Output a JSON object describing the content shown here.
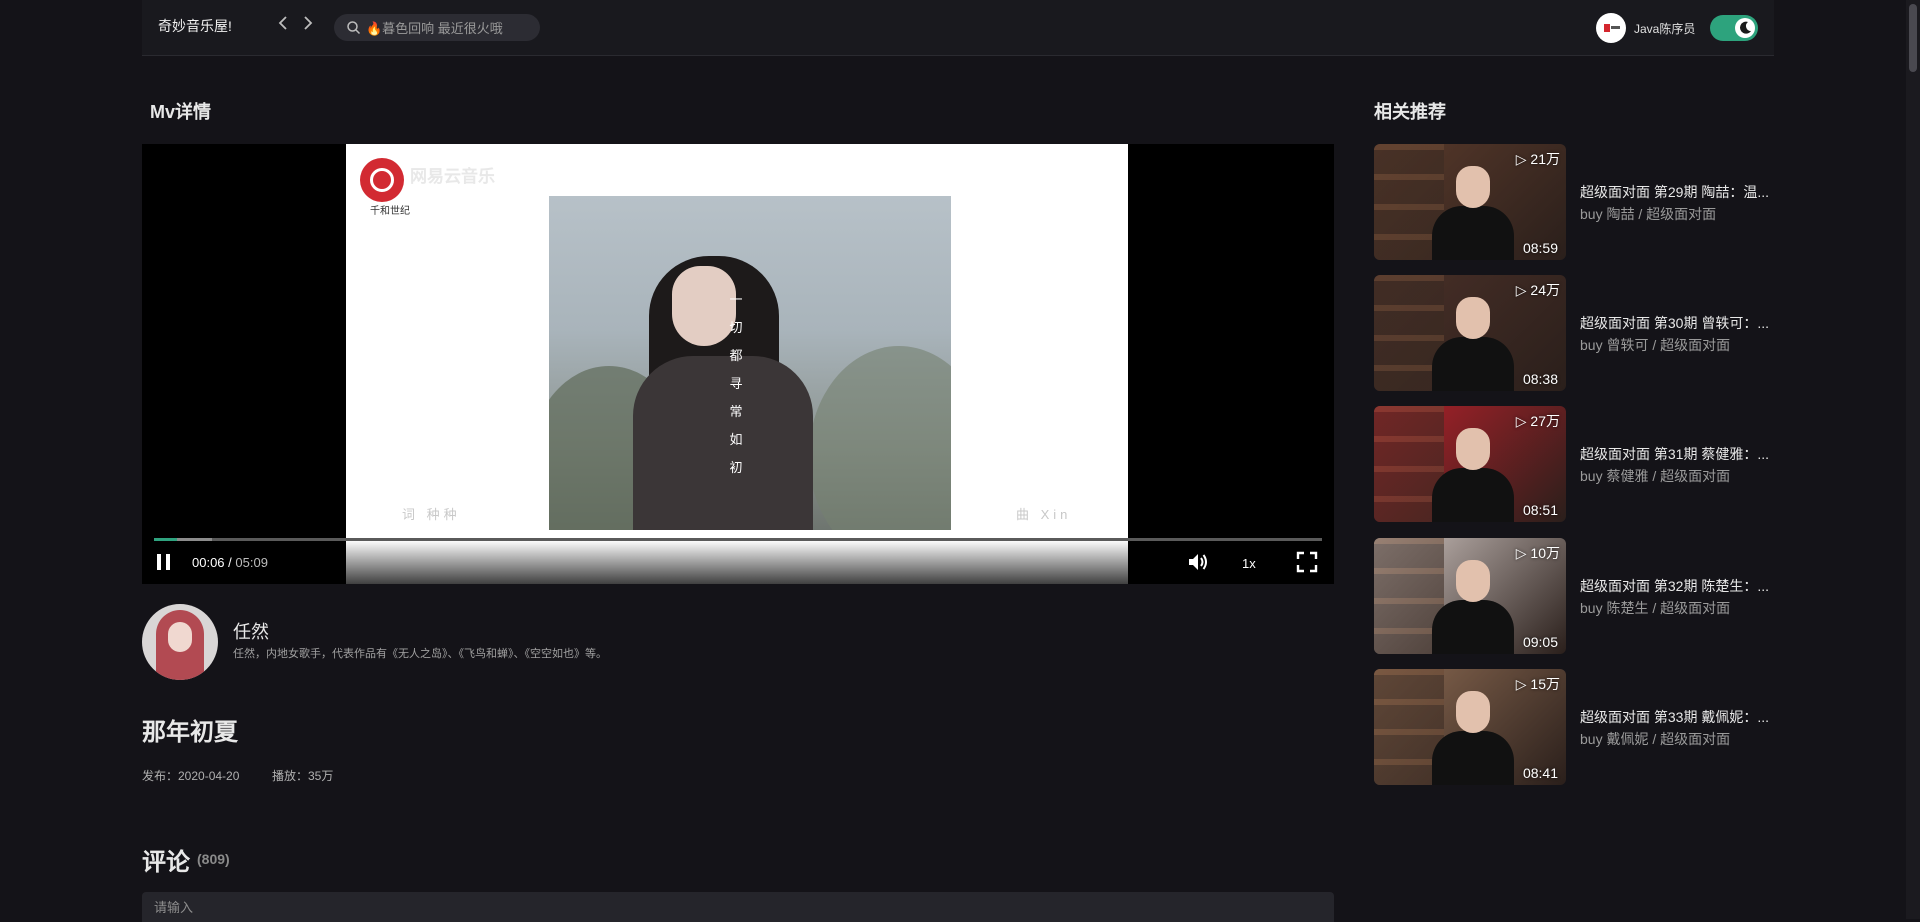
{
  "header": {
    "brand": "奇妙音乐屋!",
    "search_placeholder": "🔥暮色回响 最近很火哦",
    "username": "Java陈序员"
  },
  "main": {
    "section_title": "Mv详情",
    "video": {
      "overlay_brand": "网易云音乐",
      "overlay_label": "千和世纪",
      "vertical_lyric": "一切都寻常如初",
      "credit_left": "词 种种",
      "credit_right": "曲 Xin",
      "current_time": "00:06",
      "separator": "/",
      "duration": "05:09",
      "speed": "1x",
      "progress_percent": 2,
      "buffer_percent": 5
    },
    "artist": {
      "name": "任然",
      "description": "任然，内地女歌手，代表作品有《无人之岛》、《飞鸟和蝉》、《空空如也》等。"
    },
    "mv_title": "那年初夏",
    "publish": "发布：2020-04-20",
    "plays": "播放：35万",
    "comments": {
      "title": "评论",
      "count": "(809)",
      "input_placeholder": "请输入"
    }
  },
  "sidebar": {
    "title": "相关推荐",
    "items": [
      {
        "play_count": "▷ 21万",
        "duration": "08:59",
        "title": "超级面对面 第29期 陶喆：温...",
        "subtitle": "buy 陶喆 / 超级面对面",
        "color": "#5a3a2b"
      },
      {
        "play_count": "▷ 24万",
        "duration": "08:38",
        "title": "超级面对面 第30期 曾轶可：...",
        "subtitle": "buy 曾轶可 / 超级面对面",
        "color": "#4a3028"
      },
      {
        "play_count": "▷ 27万",
        "duration": "08:51",
        "title": "超级面对面 第31期 蔡健雅：...",
        "subtitle": "buy 蔡健雅 / 超级面对面",
        "color": "#b4202a"
      },
      {
        "play_count": "▷ 10万",
        "duration": "09:05",
        "title": "超级面对面 第32期 陈楚生：...",
        "subtitle": "buy 陈楚生 / 超级面对面",
        "color": "#cfc4c0"
      },
      {
        "play_count": "▷ 15万",
        "duration": "08:41",
        "title": "超级面对面 第33期 戴佩妮：...",
        "subtitle": "buy 戴佩妮 / 超级面对面",
        "color": "#8c6a52"
      }
    ]
  },
  "colors": {
    "accent": "#2fa37f",
    "background": "#141318"
  },
  "icons": [
    "chevron-left-icon",
    "chevron-right-icon",
    "search-icon",
    "moon-icon",
    "pause-icon",
    "volume-icon",
    "fullscreen-icon"
  ]
}
